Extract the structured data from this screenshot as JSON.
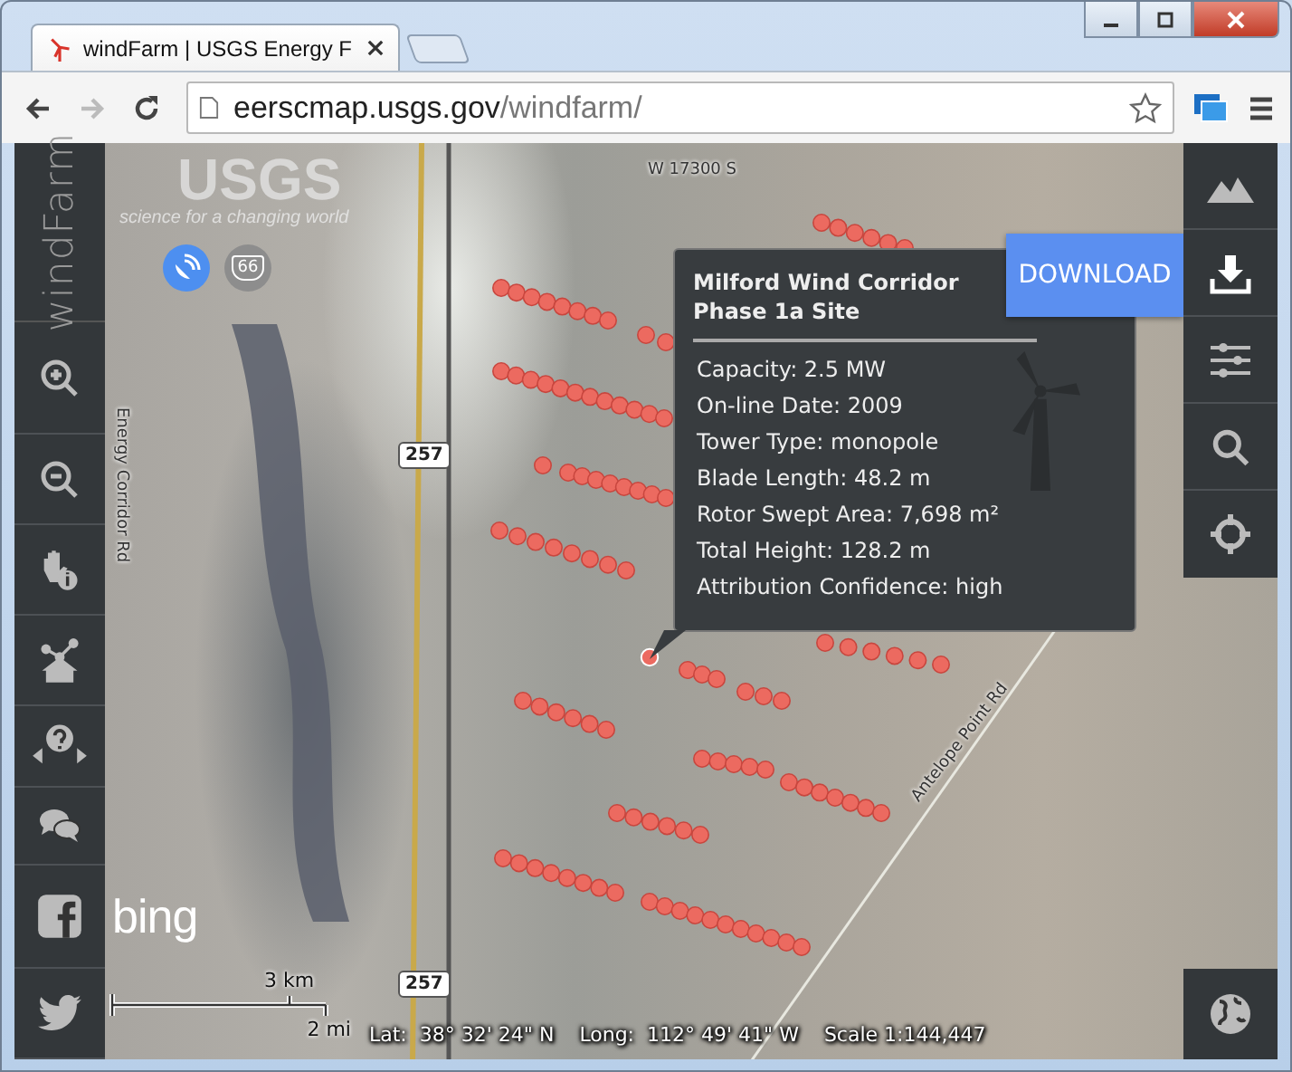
{
  "browser": {
    "tab_title": "windFarm | USGS Energy F",
    "url_host": "eerscmap.usgs.gov",
    "url_path": "/windfarm/"
  },
  "app": {
    "logo": "windFarm"
  },
  "map": {
    "usgs_logo": "USGS",
    "usgs_tagline": "science for a changing world",
    "route_badge": "66",
    "road_labels": [
      {
        "text": "W 17300 S",
        "kind": "horizontal"
      },
      {
        "text": "Energy Corridor Rd",
        "kind": "vertical"
      },
      {
        "text": "Antelope Point Rd",
        "kind": "diagonal"
      }
    ],
    "route_shields": [
      "257",
      "257"
    ],
    "bing_logo": "bing"
  },
  "popup": {
    "title": "Milford Wind Corridor Phase 1a Site",
    "fields": [
      "Capacity: 2.5 MW",
      "On-line Date: 2009",
      "Tower Type: monopole",
      "Blade Length: 48.2 m",
      "Rotor Swept Area: 7,698 m²",
      "Total Height: 128.2 m",
      "Attribution Confidence: high"
    ]
  },
  "download_tooltip": "DOWNLOAD",
  "scale_bar": {
    "metric": "3 km",
    "imperial": "2 mi"
  },
  "status": {
    "lat": "Lat:  38° 32' 24\" N",
    "long": "Long:  112° 49' 41\" W",
    "scale": "Scale 1:144,447"
  }
}
